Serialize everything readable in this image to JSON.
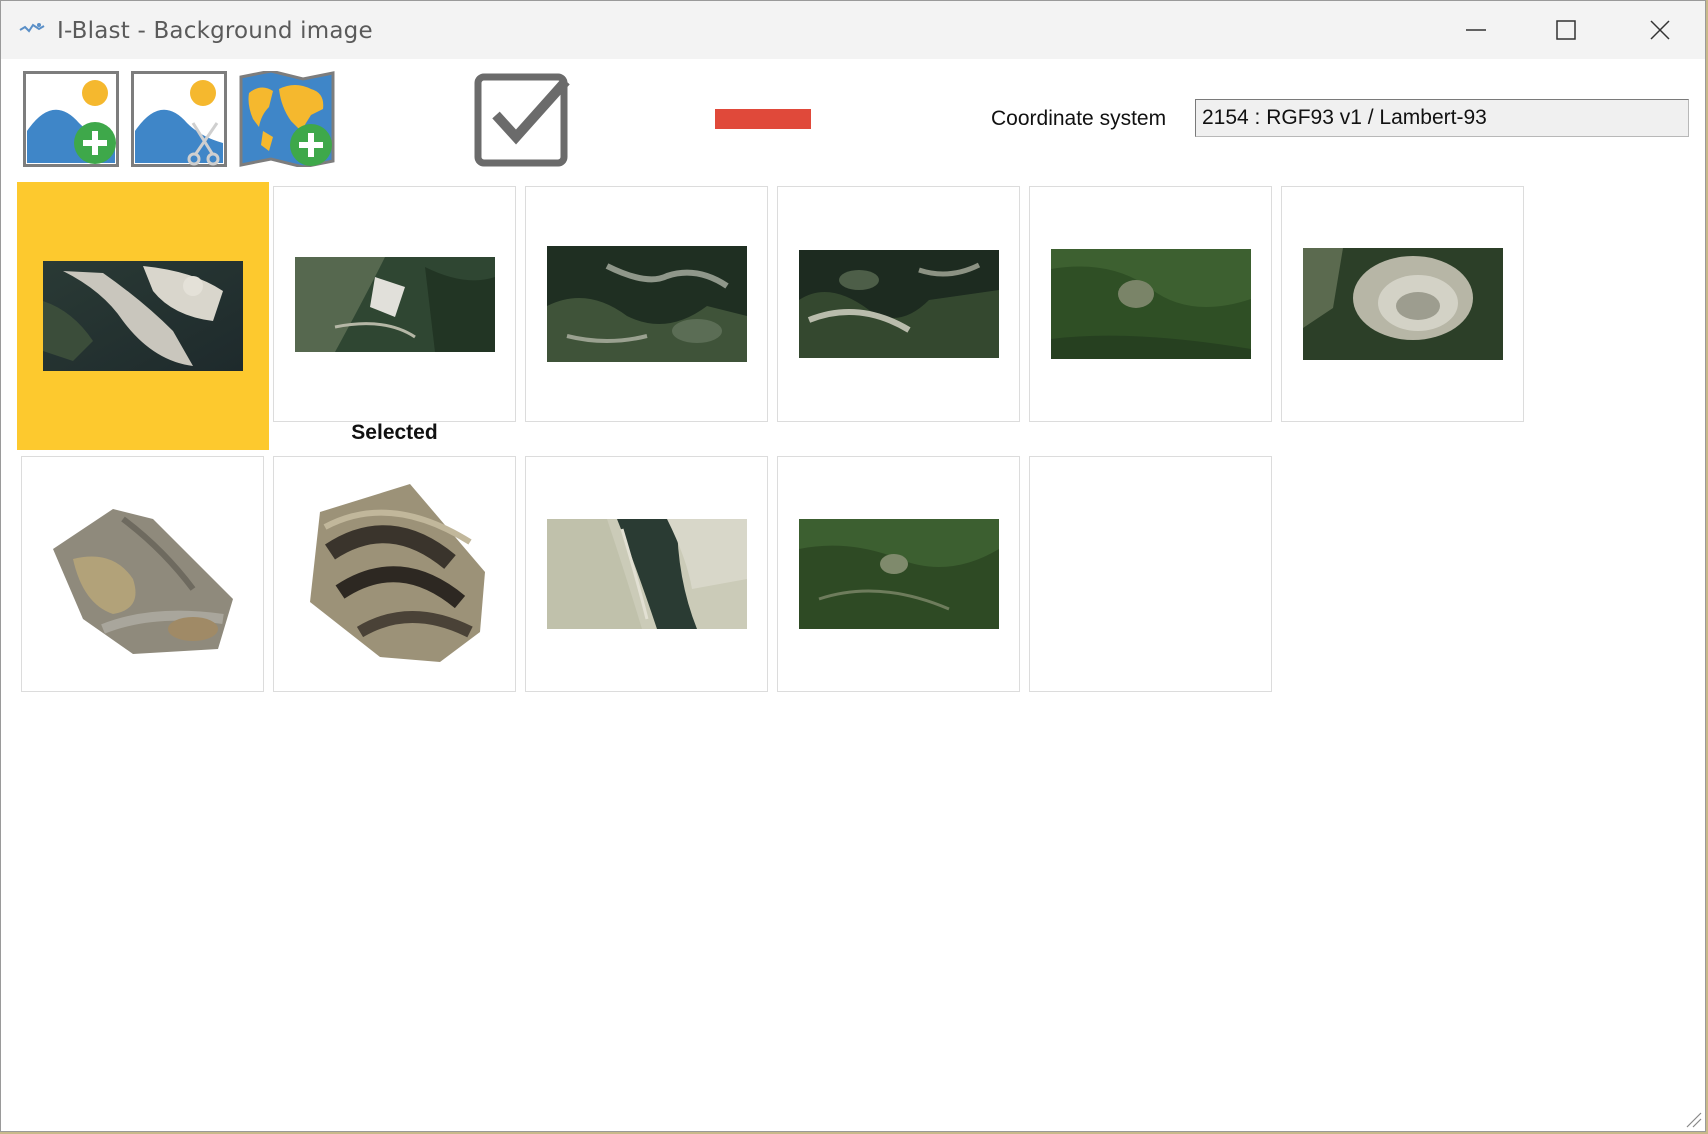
{
  "window": {
    "title": "I-Blast - Background image"
  },
  "toolbar": {
    "buttons": [
      {
        "name": "add-image",
        "icon": "image-add-icon"
      },
      {
        "name": "crop-image",
        "icon": "image-scissors-icon"
      },
      {
        "name": "add-map",
        "icon": "world-map-add-icon"
      },
      {
        "name": "validate",
        "icon": "checkbox-check-icon"
      }
    ],
    "indicator_color": "#e0493a",
    "coordinate_label": "Coordinate system",
    "coordinate_value": "2154 : RGF93 v1 / Lambert-93"
  },
  "gallery": {
    "selected_index": 0,
    "selected_label": "Selected",
    "highlight_color": "#fdc92e",
    "tiles": [
      {
        "name": "thumbnail-1",
        "kind": "aerial-mixed"
      },
      {
        "name": "thumbnail-2",
        "kind": "aerial-forest-quarry"
      },
      {
        "name": "thumbnail-3",
        "kind": "aerial-dark-forest"
      },
      {
        "name": "thumbnail-4",
        "kind": "aerial-dark-forest"
      },
      {
        "name": "thumbnail-5",
        "kind": "aerial-green"
      },
      {
        "name": "thumbnail-6",
        "kind": "aerial-quarry"
      },
      {
        "name": "thumbnail-7",
        "kind": "drone-quarry"
      },
      {
        "name": "thumbnail-8",
        "kind": "drone-pit"
      },
      {
        "name": "thumbnail-9",
        "kind": "aerial-river"
      },
      {
        "name": "thumbnail-10",
        "kind": "aerial-green"
      },
      {
        "name": "thumbnail-11",
        "kind": "empty"
      }
    ]
  }
}
